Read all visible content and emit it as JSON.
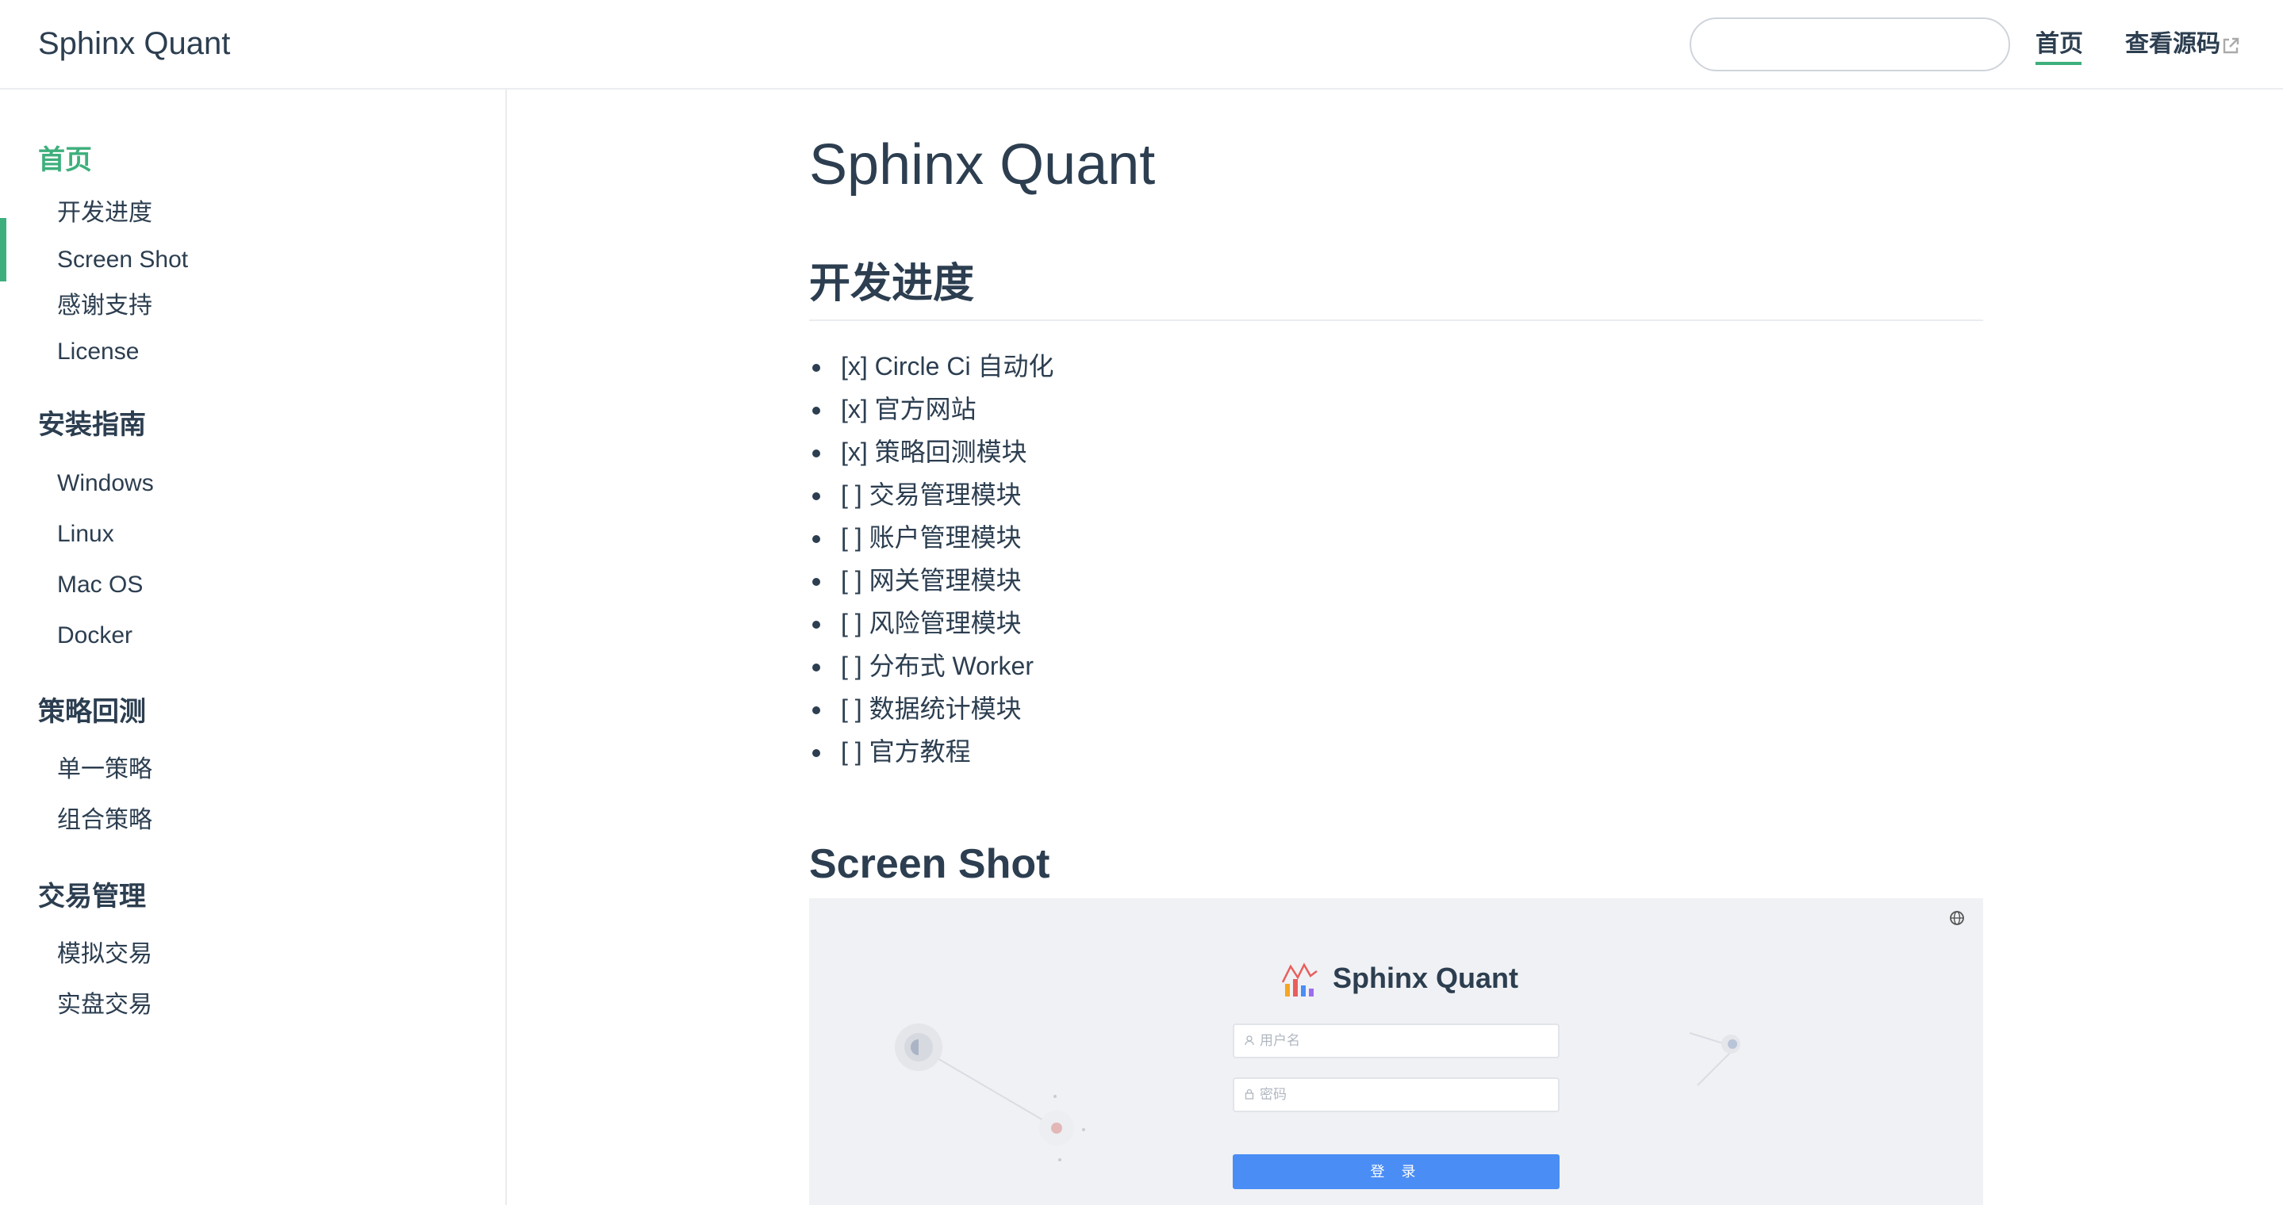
{
  "navbar": {
    "site_name": "Sphinx Quant",
    "search_value": "",
    "search_placeholder": "",
    "links": [
      {
        "label": "首页",
        "active": true
      },
      {
        "label": "查看源码",
        "external": true
      }
    ],
    "accent_color": "#3eaf7c"
  },
  "sidebar": {
    "groups": [
      {
        "label": "首页",
        "active": true,
        "items": [
          "开发进度",
          "Screen Shot",
          "感谢支持",
          "License"
        ]
      },
      {
        "label": "安装指南",
        "items": [
          "Windows",
          "Linux",
          "Mac OS",
          "Docker"
        ]
      },
      {
        "label": "策略回测",
        "items": [
          "单一策略",
          "组合策略"
        ]
      },
      {
        "label": "交易管理",
        "items": [
          "模拟交易",
          "实盘交易"
        ]
      }
    ]
  },
  "content": {
    "title": "Sphinx Quant",
    "section1_heading": "开发进度",
    "checklist": [
      "[x] Circle Ci 自动化",
      "[x] 官方网站",
      "[x] 策略回测模块",
      "[ ] 交易管理模块",
      "[ ] 账户管理模块",
      "[ ] 网关管理模块",
      "[ ] 风险管理模块",
      "[ ] 分布式 Worker",
      "[ ] 数据统计模块",
      "[ ] 官方教程"
    ],
    "section2_heading": "Screen Shot"
  },
  "screenshot": {
    "logo_text": "Sphinx Quant",
    "username_placeholder": "用户名",
    "password_placeholder": "密码",
    "login_label": "登 录",
    "button_color": "#4a8df5",
    "icons": [
      "globe-icon",
      "user-icon",
      "lock-icon"
    ]
  }
}
